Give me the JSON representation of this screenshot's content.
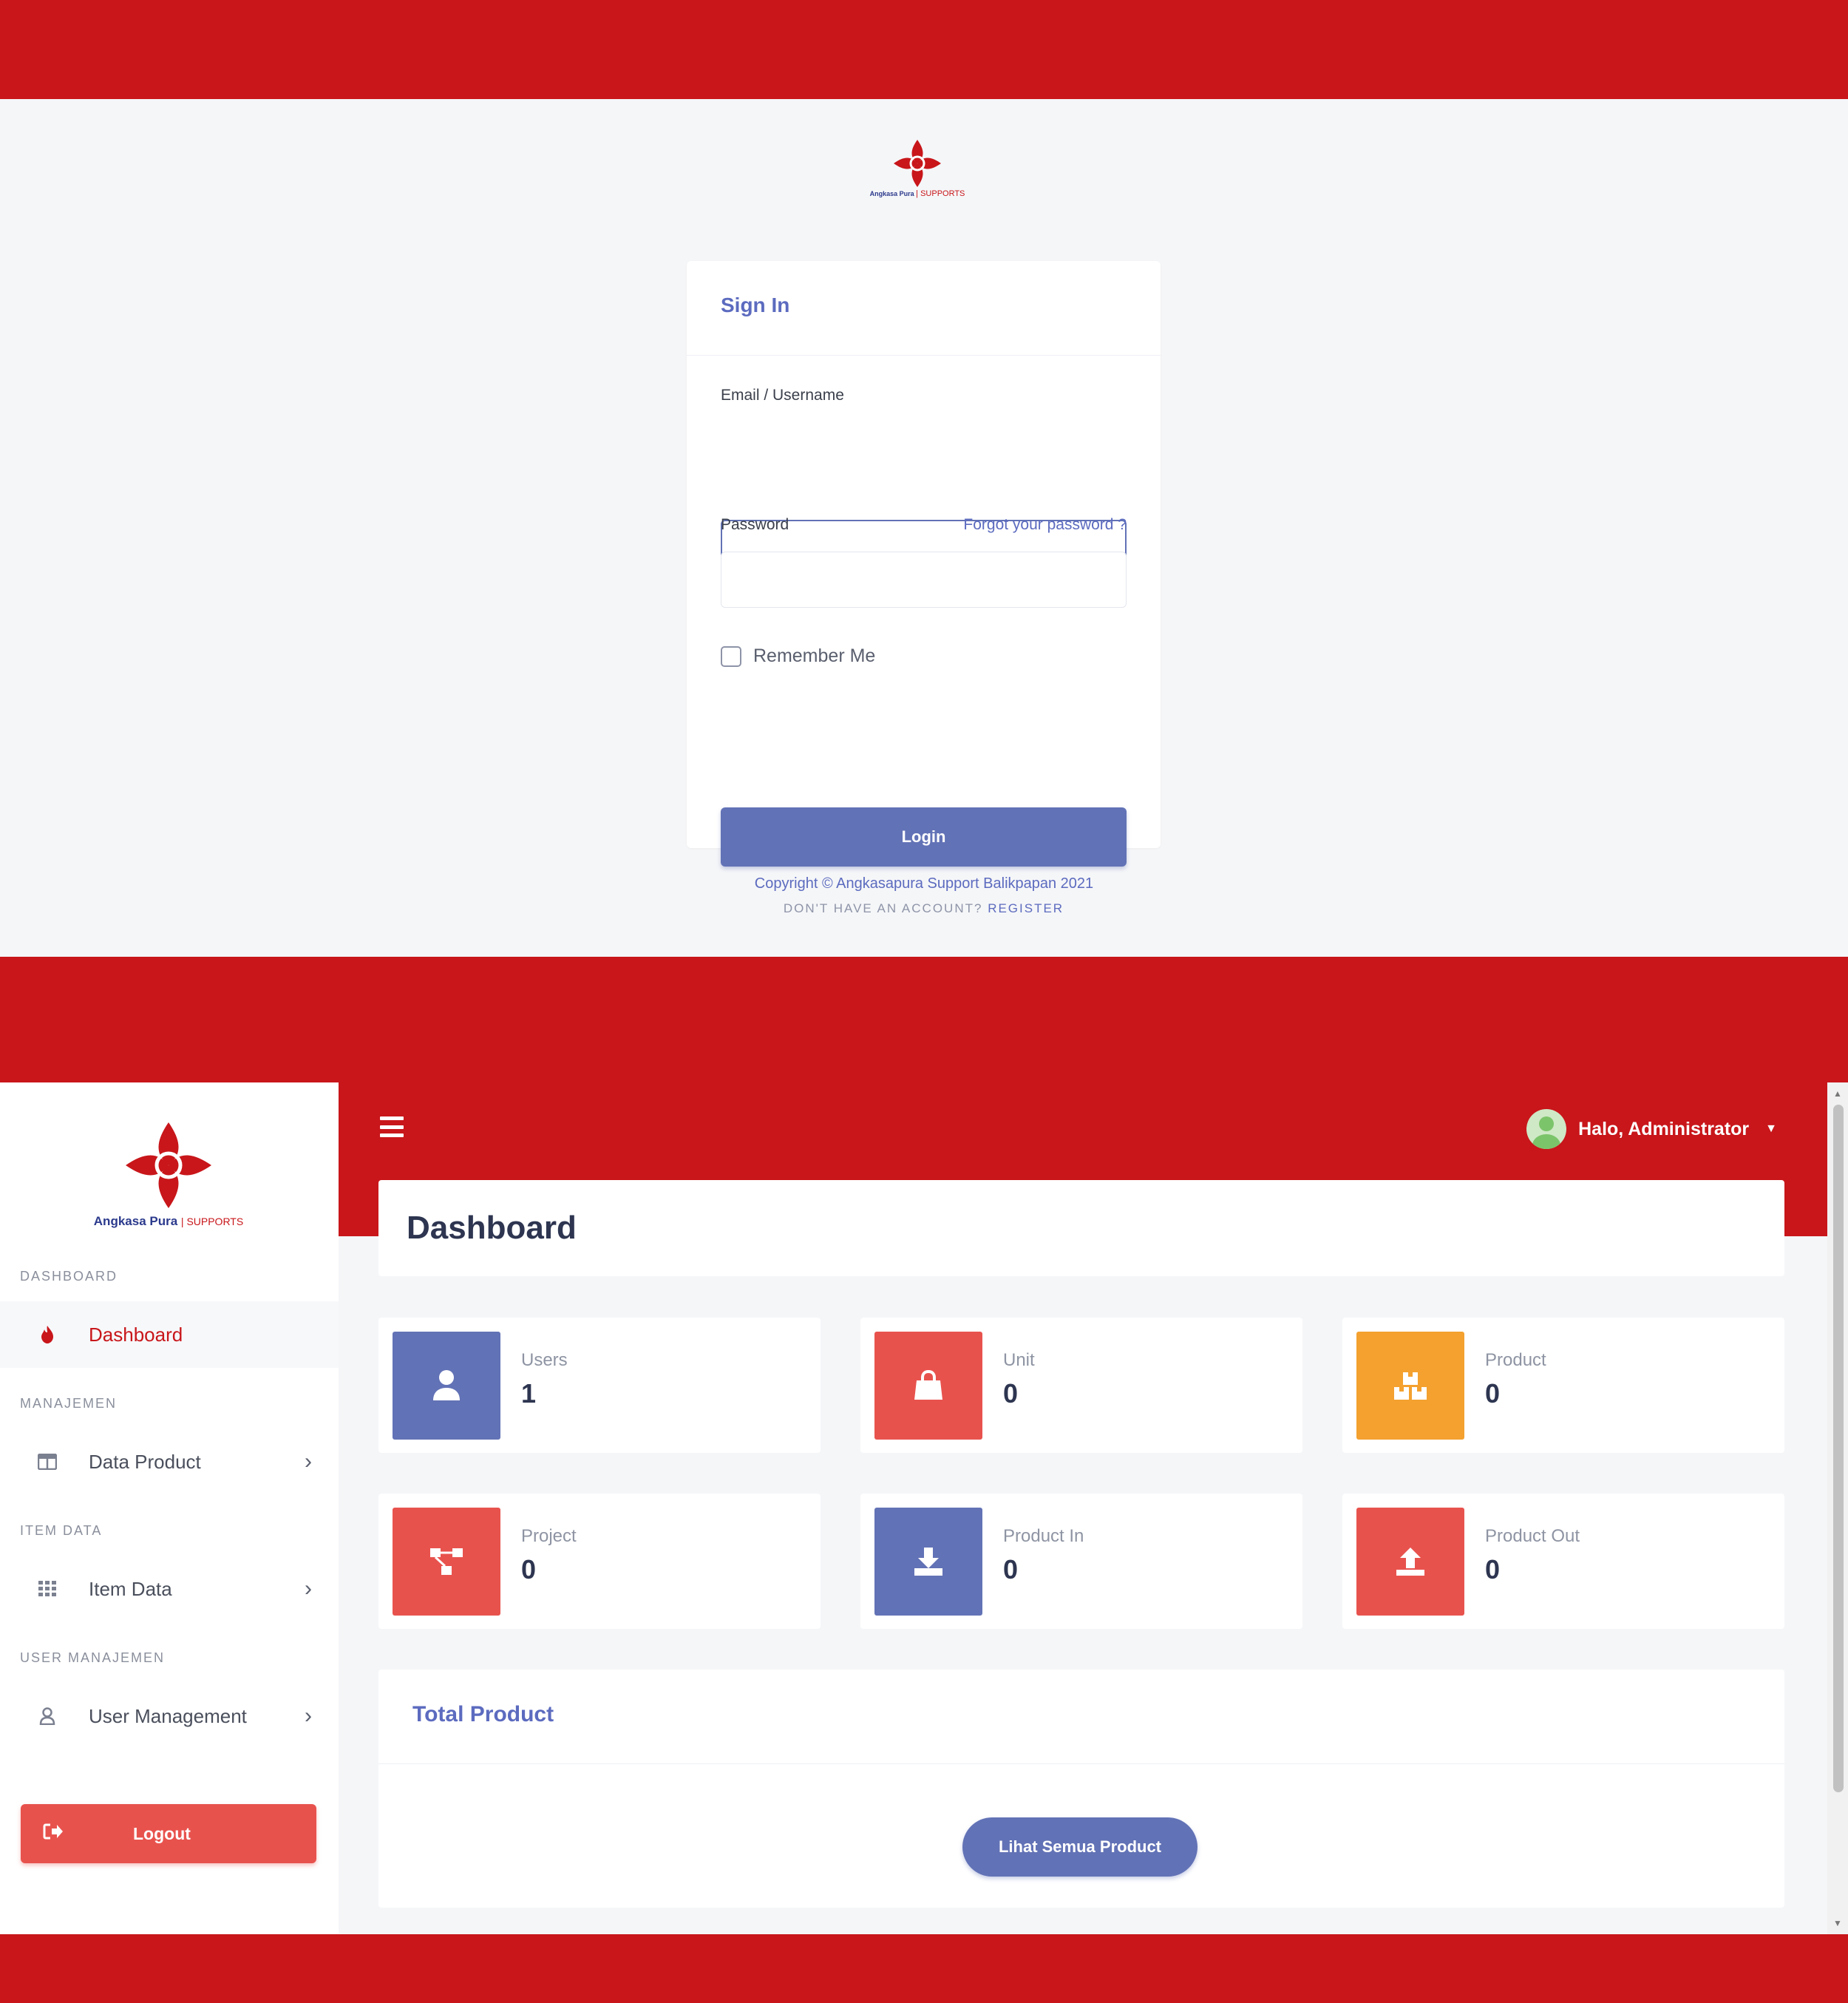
{
  "brand": {
    "name": "Angkasa Pura",
    "suffix": "SUPPORTS",
    "color_primary": "#c8161a",
    "color_accent": "#6272b6"
  },
  "login": {
    "title": "Sign In",
    "email_label": "Email / Username",
    "email_value": "",
    "password_label": "Password",
    "password_value": "",
    "forgot_label": "Forgot your password ?",
    "remember_label": "Remember Me",
    "remember_checked": false,
    "login_label": "Login",
    "register_prompt": "DON'T HAVE AN ACCOUNT?",
    "register_link": "REGISTER",
    "copyright": "Copyright © Angkasapura Support Balikpapan 2021"
  },
  "sidebar": {
    "sections": [
      {
        "title": "DASHBOARD",
        "item": {
          "label": "Dashboard",
          "icon": "fire-icon",
          "active": true,
          "has_submenu": false
        }
      },
      {
        "title": "MANAJEMEN",
        "item": {
          "label": "Data Product",
          "icon": "table-icon",
          "active": false,
          "has_submenu": true
        }
      },
      {
        "title": "ITEM DATA",
        "item": {
          "label": "Item Data",
          "icon": "grid-icon",
          "active": false,
          "has_submenu": true
        }
      },
      {
        "title": "USER MANAJEMEN",
        "item": {
          "label": "User Management",
          "icon": "user-icon",
          "active": false,
          "has_submenu": true
        }
      }
    ],
    "logout_label": "Logout"
  },
  "topbar": {
    "user_greeting": "Halo, Administrator"
  },
  "dashboard": {
    "title": "Dashboard",
    "stats": [
      {
        "label": "Users",
        "value": "1",
        "icon": "user-icon",
        "color": "#6272b6"
      },
      {
        "label": "Unit",
        "value": "0",
        "icon": "shopping-bag-icon",
        "color": "#e8524d"
      },
      {
        "label": "Product",
        "value": "0",
        "icon": "boxes-icon",
        "color": "#f4a12f"
      },
      {
        "label": "Project",
        "value": "0",
        "icon": "project-diagram-icon",
        "color": "#e8524d"
      },
      {
        "label": "Product In",
        "value": "0",
        "icon": "download-icon",
        "color": "#6272b6"
      },
      {
        "label": "Product Out",
        "value": "0",
        "icon": "upload-icon",
        "color": "#e8524d"
      }
    ],
    "total_product_title": "Total Product",
    "all_products_button": "Lihat Semua Product"
  }
}
